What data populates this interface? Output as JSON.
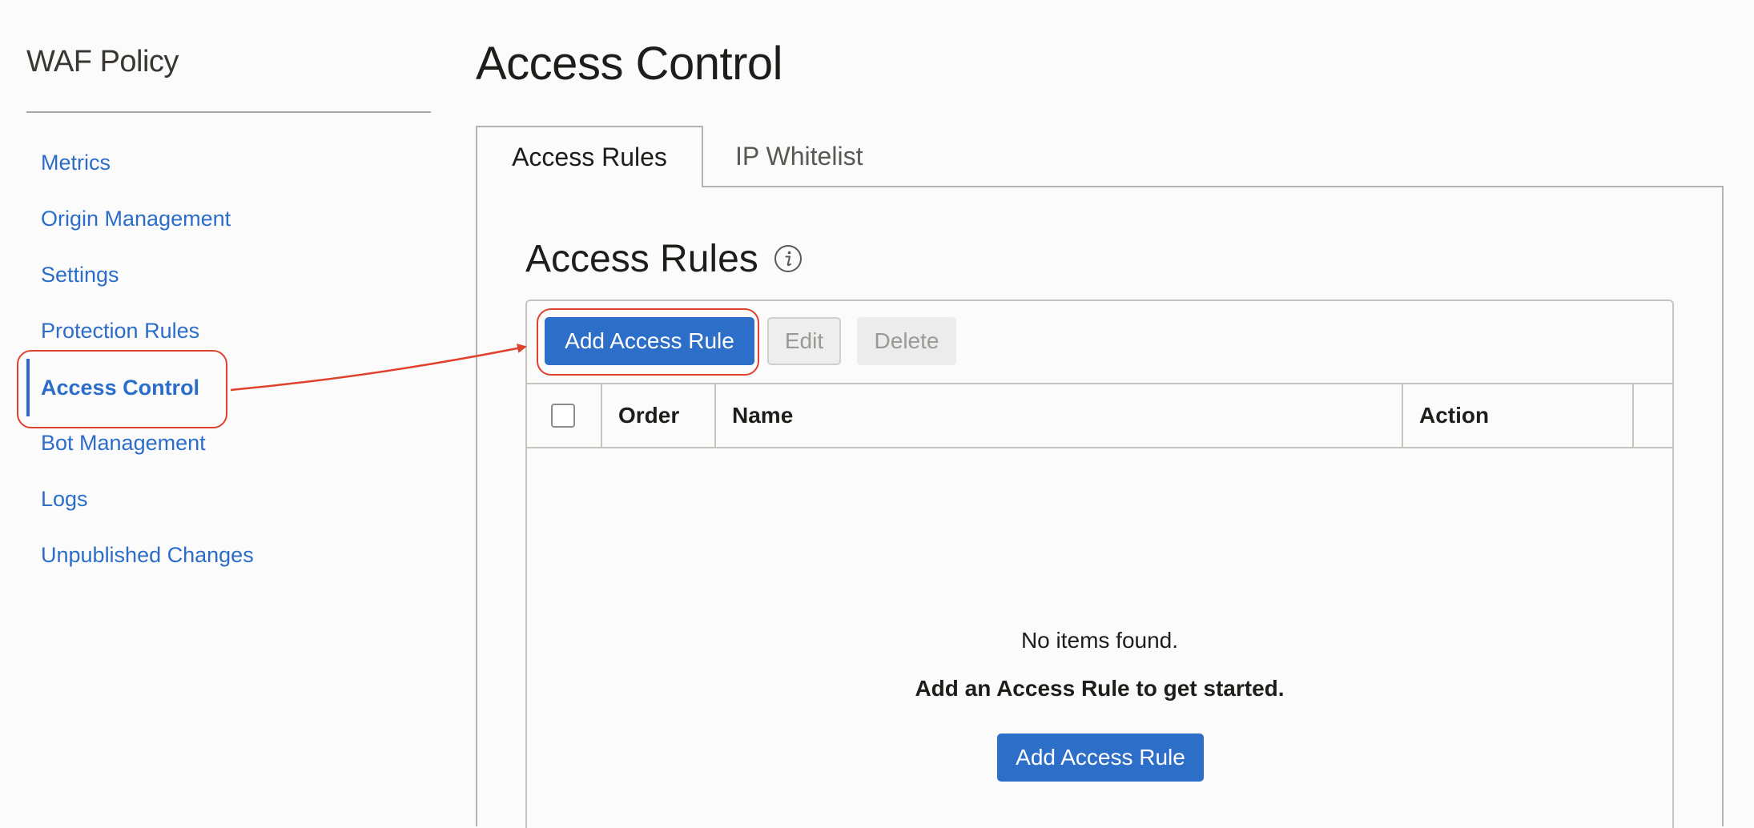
{
  "sidebar": {
    "title": "WAF Policy",
    "items": [
      {
        "label": "Metrics",
        "active": false
      },
      {
        "label": "Origin Management",
        "active": false
      },
      {
        "label": "Settings",
        "active": false
      },
      {
        "label": "Protection Rules",
        "active": false
      },
      {
        "label": "Access Control",
        "active": true
      },
      {
        "label": "Bot Management",
        "active": false
      },
      {
        "label": "Logs",
        "active": false
      },
      {
        "label": "Unpublished Changes",
        "active": false
      }
    ]
  },
  "main": {
    "title": "Access Control",
    "tabs": [
      {
        "label": "Access Rules",
        "active": true
      },
      {
        "label": "IP Whitelist",
        "active": false
      }
    ],
    "section": {
      "heading": "Access Rules",
      "info_icon": "info-icon"
    },
    "toolbar": {
      "add_label": "Add Access Rule",
      "edit_label": "Edit",
      "delete_label": "Delete"
    },
    "table": {
      "columns": [
        "Order",
        "Name",
        "Action"
      ],
      "empty_title": "No items found.",
      "empty_hint": "Add an Access Rule to get started.",
      "empty_button_label": "Add Access Rule"
    }
  },
  "colors": {
    "accent": "#2d6ec8",
    "link": "#2b6dc8",
    "annotation": "#e0412d"
  }
}
